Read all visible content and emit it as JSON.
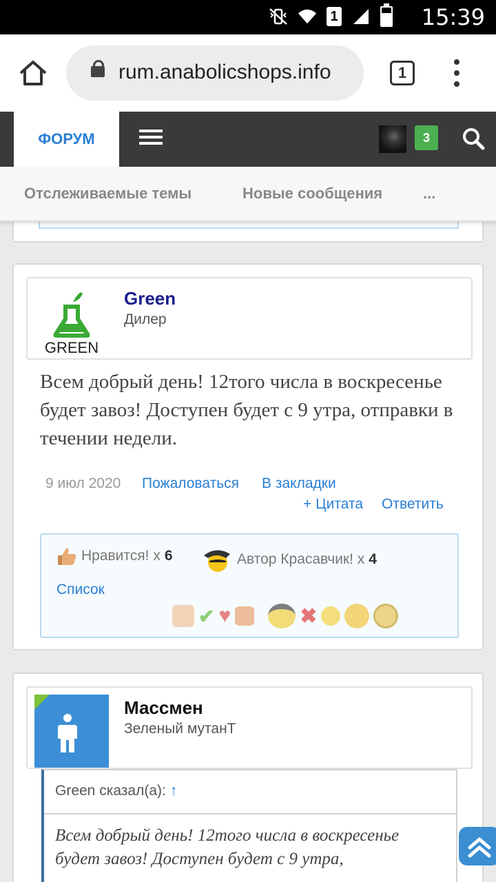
{
  "status_bar": {
    "time": "15:39",
    "sim_slot": "1",
    "icons": [
      "mute-vibrate-icon",
      "wifi-icon",
      "sim-icon",
      "signal-icon",
      "battery-icon"
    ]
  },
  "browser": {
    "url": "rum.anabolicshops.info",
    "tab_count": "1"
  },
  "site_nav": {
    "forum_tab": "ФОРУМ",
    "notification_count": "3"
  },
  "sub_nav": {
    "items": [
      "Отслеживаемые темы",
      "Новые сообщения",
      "..."
    ]
  },
  "post1": {
    "author": "Green",
    "author_title": "Дилер",
    "avatar_text": "GREEN",
    "message": "Всем добрый день! 12того числа в воскресенье будет завоз! Доступен будет с 9 утра, отправки в течении недели.",
    "date": "9 июл 2020",
    "report": "Пожаловаться",
    "bookmark": "В закладки",
    "quote": "+ Цитата",
    "reply": "Ответить",
    "reactions": {
      "like_label": "Нравится! x",
      "like_count": "6",
      "cool_label": "Автор Красавчик! x",
      "cool_count": "4",
      "list_label": "Список"
    }
  },
  "post2": {
    "author": "Массмен",
    "author_title": "Зеленый мутанТ",
    "quote_author": "Green сказал(а):",
    "quote_arrow": "↑",
    "quote_text": "Всем добрый день! 12того числа в воскресенье будет завоз! Доступен будет с 9 утра,"
  },
  "colors": {
    "accent": "#2a7fd4",
    "nav_bg": "#3a3a3a",
    "badge": "#4caf50"
  }
}
